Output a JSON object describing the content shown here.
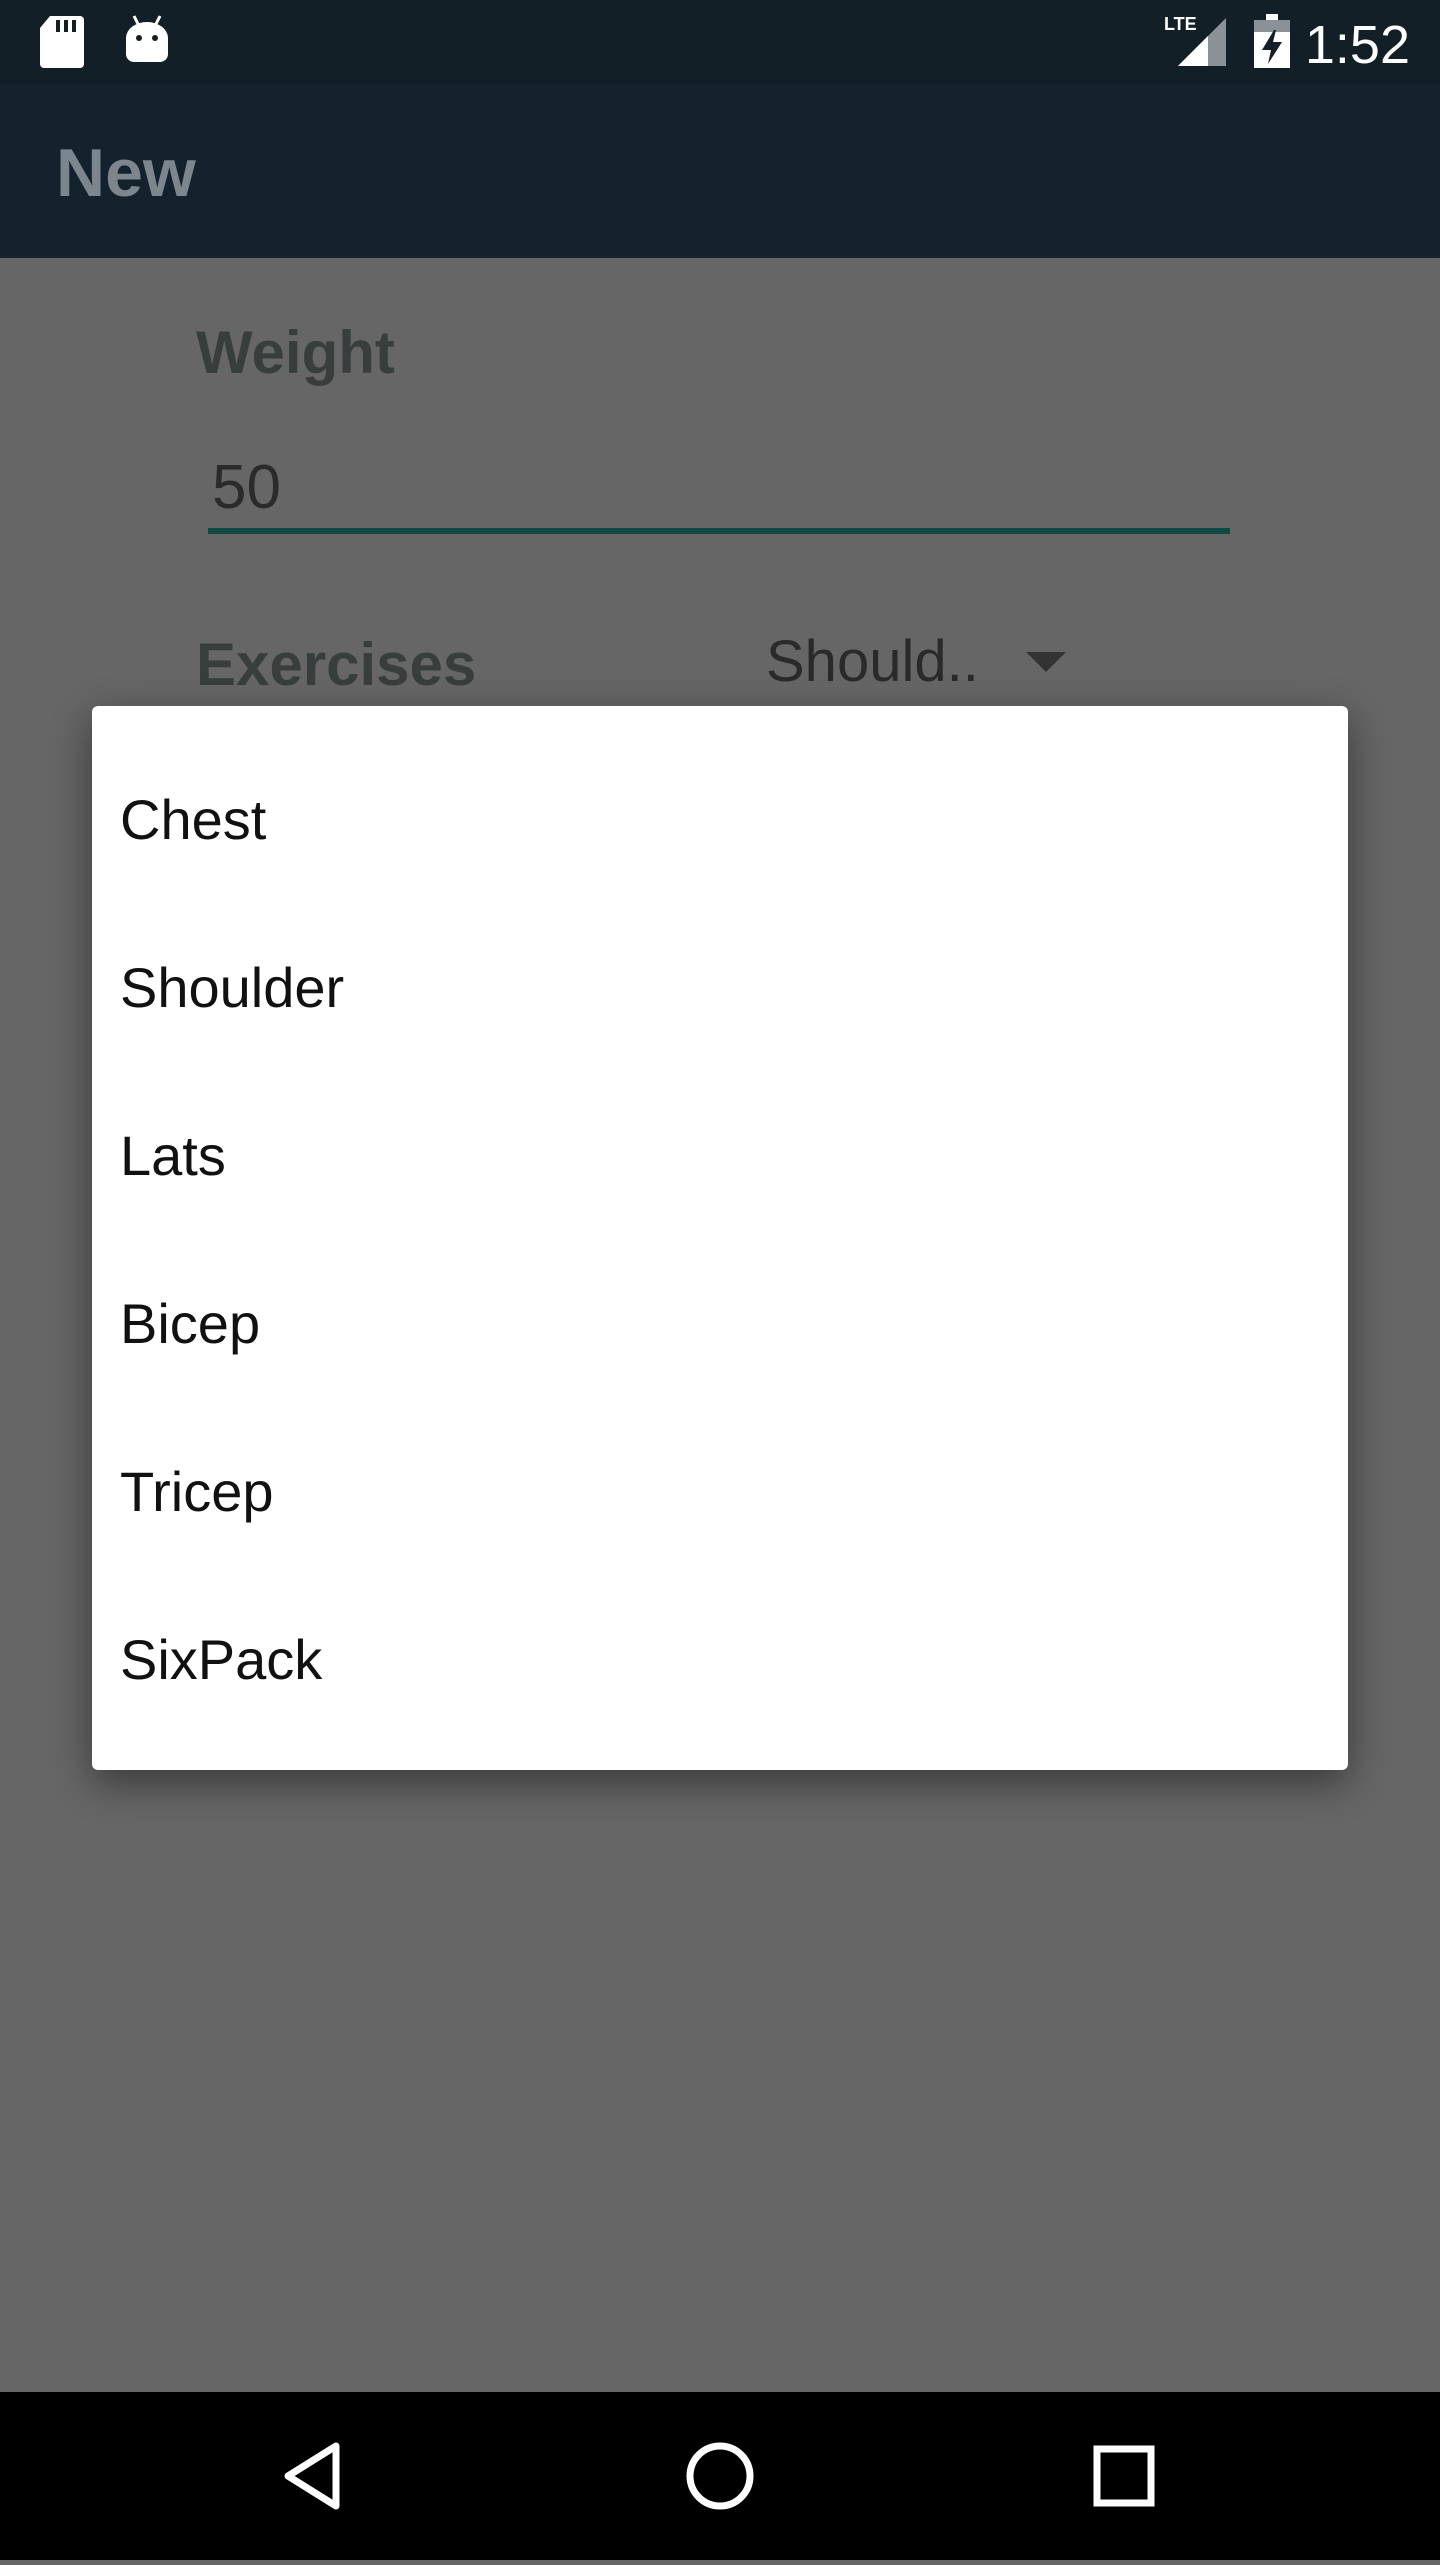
{
  "status_bar": {
    "time": "1:52",
    "network": "LTE",
    "icons": [
      "sd-card-icon",
      "android-icon",
      "lte-signal-icon",
      "battery-charging-icon"
    ]
  },
  "app_bar": {
    "title": "New"
  },
  "form": {
    "weight_label": "Weight",
    "weight_value": "50",
    "exercises_label": "Exercises",
    "exercises_selected": "Should.."
  },
  "dropdown": {
    "items": [
      {
        "label": "Chest"
      },
      {
        "label": "Shoulder"
      },
      {
        "label": "Lats"
      },
      {
        "label": "Bicep"
      },
      {
        "label": "Tricep"
      },
      {
        "label": "SixPack"
      }
    ]
  },
  "nav_bar": {
    "buttons": [
      "back-icon",
      "home-icon",
      "recents-icon"
    ]
  },
  "colors": {
    "status_bar": "#121f27",
    "app_bar": "#13222c",
    "scrim_background": "#666666",
    "accent_underline": "#0f4a42"
  }
}
